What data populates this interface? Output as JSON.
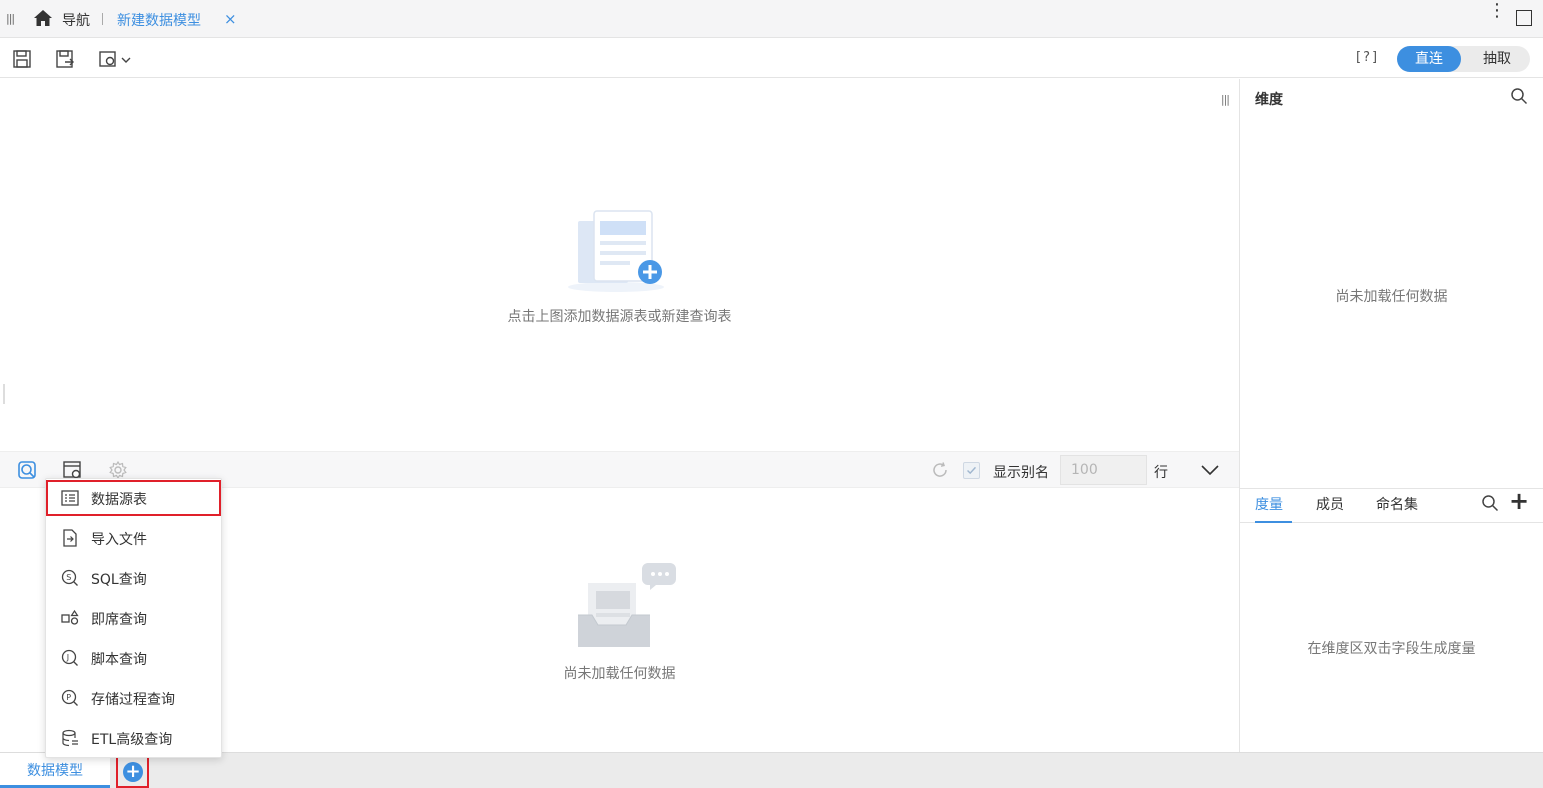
{
  "top_tabs": {
    "nav_label": "导航",
    "active_tab_label": "新建数据模型",
    "close_glyph": "×",
    "more_glyph": "⋮"
  },
  "toolbar": {
    "help_label": "[?]",
    "mode_direct": "直连",
    "mode_extract": "抽取",
    "icons": [
      "save-icon",
      "save-as-icon",
      "settings-dropdown-icon"
    ]
  },
  "canvas": {
    "hint": "点击上图添加数据源表或新建查询表"
  },
  "preview_toolbar": {
    "show_alias_label": "显示别名",
    "rows_placeholder": "100",
    "rows_unit": "行"
  },
  "preview": {
    "empty_text": "尚未加载任何数据"
  },
  "right_panel": {
    "dimension_title": "维度",
    "dimension_empty": "尚未加载任何数据",
    "tabs": [
      {
        "label": "度量",
        "active": true
      },
      {
        "label": "成员",
        "active": false
      },
      {
        "label": "命名集",
        "active": false
      }
    ],
    "measure_empty": "在维度区双击字段生成度量",
    "plus_glyph": "+"
  },
  "bottom_tabs": {
    "active_label": "数据模型",
    "add_glyph": "+"
  },
  "menu": {
    "items": [
      {
        "label": "数据源表",
        "icon": "table-icon"
      },
      {
        "label": "导入文件",
        "icon": "import-file-icon"
      },
      {
        "label": "SQL查询",
        "icon": "sql-query-icon"
      },
      {
        "label": "即席查询",
        "icon": "adhoc-query-icon"
      },
      {
        "label": "脚本查询",
        "icon": "script-query-icon"
      },
      {
        "label": "存储过程查询",
        "icon": "stored-procedure-icon"
      },
      {
        "label": "ETL高级查询",
        "icon": "etl-query-icon"
      }
    ]
  },
  "colors": {
    "accent": "#3d8fe0",
    "highlight_border": "#e0202a"
  }
}
